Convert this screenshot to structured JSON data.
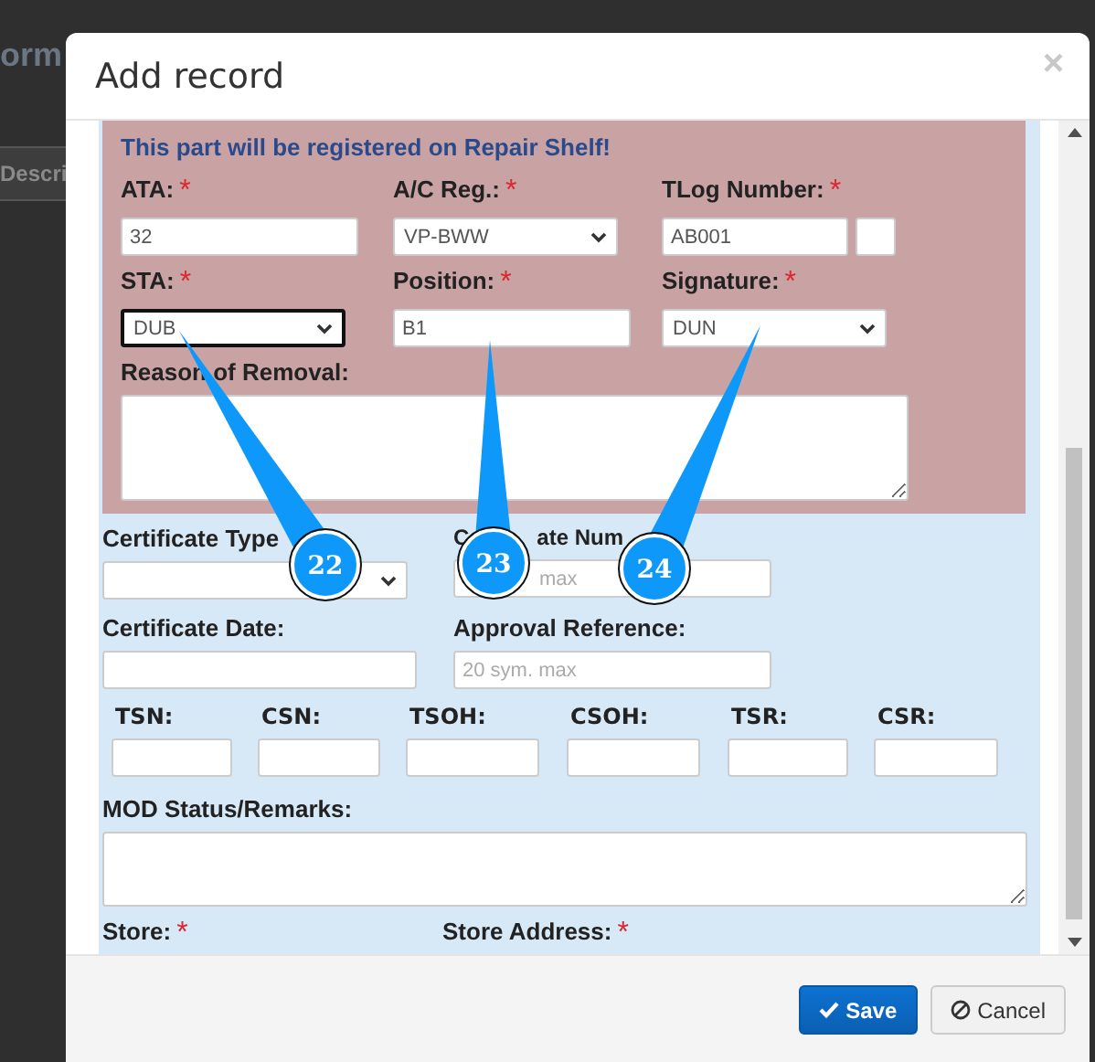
{
  "background": {
    "heading_fragment": "orm",
    "tab_fragment": "Descri"
  },
  "dialog": {
    "title": "Add record",
    "close": "×"
  },
  "repair_section": {
    "notice": "This part will be registered on Repair Shelf!",
    "rows": [
      [
        {
          "kind": "input",
          "label": "ATA:",
          "asterisk": "*",
          "value": "32"
        },
        {
          "kind": "select",
          "label": "A/C Reg.:",
          "asterisk": "*",
          "value": "VP-BWW",
          "focused": false
        },
        {
          "kind": "pair",
          "label": "TLog Number:",
          "asterisk": "*",
          "value": "AB001"
        }
      ],
      [
        {
          "kind": "select",
          "label": "STA:",
          "asterisk": "*",
          "value": "DUB",
          "focused": true
        },
        {
          "kind": "input",
          "label": "Position:",
          "asterisk": "*",
          "value": "B1"
        },
        {
          "kind": "select",
          "label": "Signature:",
          "asterisk": "*",
          "value": "DUN",
          "focused": false
        }
      ]
    ],
    "reason": {
      "label": "Reason of Removal:"
    }
  },
  "certificate_rows": [
    [
      {
        "kind": "select",
        "label": "Certificate Type",
        "focused": false
      },
      {
        "kind": "input",
        "label_parts": [
          "C",
          "ate Num"
        ],
        "placeholder": "max"
      }
    ],
    [
      {
        "kind": "input",
        "label": "Certificate Date:"
      },
      {
        "kind": "input",
        "label": "Approval Reference:",
        "placeholder": "20 sym. max"
      }
    ]
  ],
  "hours": [
    {
      "label": "TSN:"
    },
    {
      "label": "CSN:"
    },
    {
      "label": "TSOH:"
    },
    {
      "label": "CSOH:"
    },
    {
      "label": "TSR:"
    },
    {
      "label": "CSR:"
    }
  ],
  "remarks": {
    "label": "MOD Status/Remarks:"
  },
  "store_labels": [
    {
      "label": "Store:",
      "asterisk": "*"
    },
    {
      "label": "Store Address:",
      "asterisk": "*"
    }
  ],
  "buttons": [
    {
      "kind": "primary",
      "label": "Save"
    },
    {
      "kind": "default",
      "label": "Cancel"
    }
  ],
  "callouts": [
    {
      "number": "22"
    },
    {
      "number": "23"
    },
    {
      "number": "24"
    }
  ]
}
